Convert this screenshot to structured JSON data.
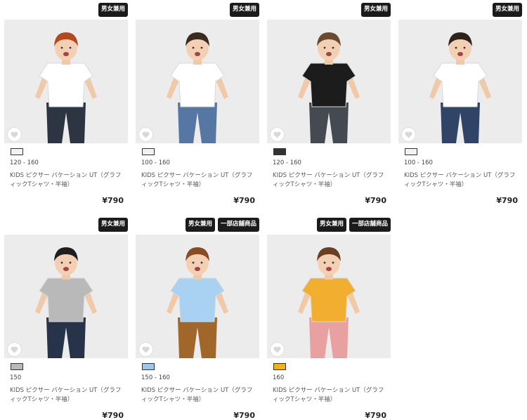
{
  "products": [
    {
      "badges": [
        "男女兼用"
      ],
      "swatch_color": "#f2f2f2",
      "sizes": "120 - 160",
      "name": "KIDS ピクサー バケーション UT（グラフィックTシャツ・半袖）",
      "price": "¥790",
      "shirt_color": "#ffffff",
      "hair_color": "#b5491e",
      "pants_color": "#2d3442"
    },
    {
      "badges": [
        "男女兼用"
      ],
      "swatch_color": "#f2f2f2",
      "sizes": "100 - 160",
      "name": "KIDS ピクサー バケーション UT（グラフィックTシャツ・半袖）",
      "price": "¥790",
      "shirt_color": "#ffffff",
      "hair_color": "#3a2a20",
      "pants_color": "#5677a3"
    },
    {
      "badges": [
        "男女兼用"
      ],
      "swatch_color": "#333333",
      "sizes": "120 - 160",
      "name": "KIDS ピクサー バケーション UT（グラフィックTシャツ・半袖）",
      "price": "¥790",
      "shirt_color": "#1c1c1c",
      "hair_color": "#6b4a2f",
      "pants_color": "#454a52"
    },
    {
      "badges": [
        "男女兼用"
      ],
      "swatch_color": "#f2f2f2",
      "sizes": "100 - 160",
      "name": "KIDS ピクサー バケーション UT（グラフィックTシャツ・半袖）",
      "price": "¥790",
      "shirt_color": "#ffffff",
      "hair_color": "#2e221a",
      "pants_color": "#2f4466"
    },
    {
      "badges": [
        "男女兼用"
      ],
      "swatch_color": "#b8b8b8",
      "sizes": "150",
      "name": "KIDS ピクサー バケーション UT（グラフィックTシャツ・半袖）",
      "price": "¥790",
      "shirt_color": "#b9b9b9",
      "hair_color": "#1e1e1e",
      "pants_color": "#263349"
    },
    {
      "badges": [
        "男女兼用",
        "一部店舗商品"
      ],
      "swatch_color": "#9cc6ea",
      "sizes": "150 - 160",
      "name": "KIDS ピクサー バケーション UT（グラフィックTシャツ・半袖）",
      "price": "¥790",
      "shirt_color": "#a9d2f2",
      "hair_color": "#8a4a22",
      "pants_color": "#a0662a"
    },
    {
      "badges": [
        "男女兼用",
        "一部店舗商品"
      ],
      "swatch_color": "#f2b21a",
      "sizes": "160",
      "name": "KIDS ピクサー バケーション UT（グラフィックTシャツ・半袖）",
      "price": "¥790",
      "shirt_color": "#f2ae2e",
      "hair_color": "#6b3f22",
      "pants_color": "#e8a0a0"
    }
  ],
  "icons": {
    "favorite": "heart-icon"
  }
}
